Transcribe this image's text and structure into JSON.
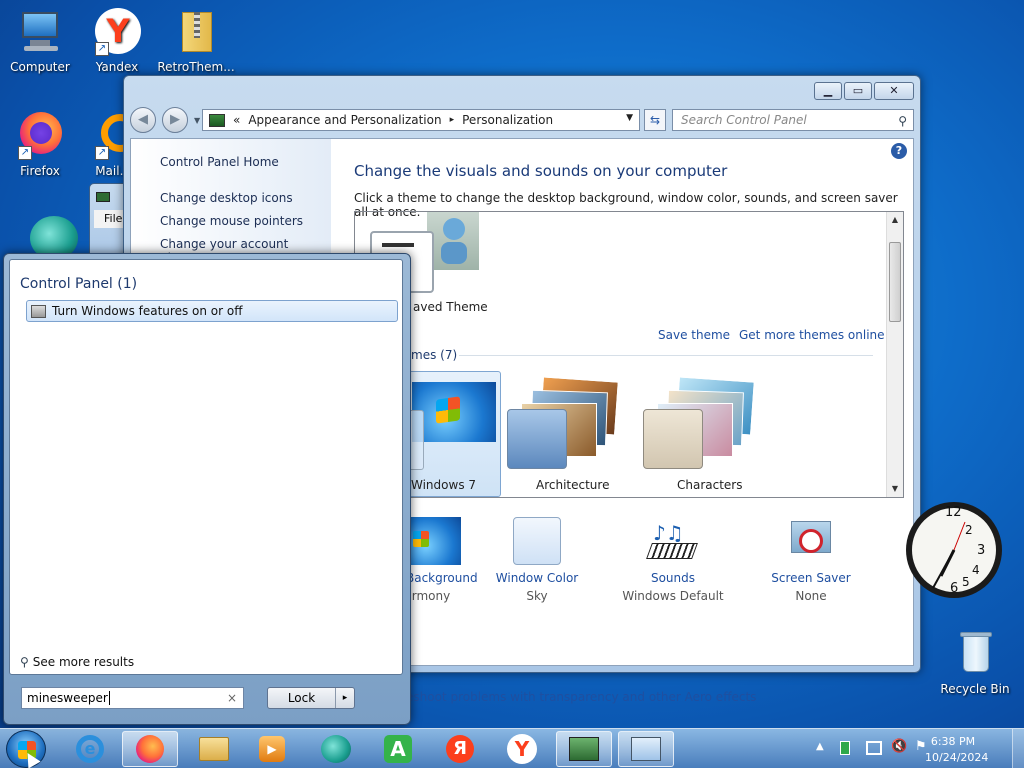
{
  "desktop": {
    "icons": [
      {
        "label": "Computer"
      },
      {
        "label": "Yandex"
      },
      {
        "label": "RetroThem..."
      },
      {
        "label": "Firefox"
      },
      {
        "label": "Mail.Ru"
      },
      {
        "label": "Recycle Bin"
      }
    ]
  },
  "window": {
    "breadcrumb_prefix": "«",
    "breadcrumb_parent": "Appearance and Personalization",
    "breadcrumb_sep": "▸",
    "breadcrumb_current": "Personalization",
    "search_placeholder": "Search Control Panel",
    "sidebar": {
      "home": "Control Panel Home",
      "links": [
        "Change desktop icons",
        "Change mouse pointers",
        "Change your account picture"
      ]
    },
    "heading": "Change the visuals and sounds on your computer",
    "subheading": "Click a theme to change the desktop background, window color, sounds, and screen saver all at once.",
    "saved_theme_label": "aved Theme",
    "save_theme": "Save theme",
    "get_more_themes": "Get more themes online",
    "group_label": "mes (7)",
    "themes": [
      "Windows 7",
      "Architecture",
      "Characters"
    ],
    "bottom": {
      "background": {
        "title": "Background",
        "sub": "rmony"
      },
      "color": {
        "title": "Window Color",
        "sub": "Sky"
      },
      "sounds": {
        "title": "Sounds",
        "sub": "Windows Default"
      },
      "saver": {
        "title": "Screen Saver",
        "sub": "None"
      }
    },
    "aero_link": "eshoot problems with transparency and other Aero effects",
    "bg_window_menu": "File"
  },
  "start_menu": {
    "category": "Control Panel (1)",
    "result": "Turn Windows features on or off",
    "see_more": "See more results",
    "search_value": "minesweeper",
    "clear": "×",
    "lock_label": "Lock",
    "lock_arrow": "▸"
  },
  "taskbar": {
    "time": "6:38 PM",
    "date": "10/24/2024"
  },
  "colors": {
    "accent": "#1f4fa0",
    "heading": "#1a3a78"
  }
}
